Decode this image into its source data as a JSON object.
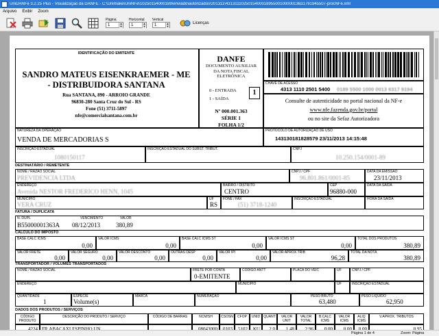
{
  "window": {
    "title": "UniDANFe 3.2.25 Plus - Visualização da DANFE - C:\\Unimake\\UniNFe\\10250154000189\\enviado\\autorizados\\201311\\43131110250154000189550010000013631791945507-procNFe.xml"
  },
  "menu": [
    "Arquivo",
    "Exibir",
    "Zoom"
  ],
  "toolbar": {
    "pagina_label": "Página",
    "pagina_value": "1",
    "horizontal_label": "Horizontal",
    "horizontal_value": "1",
    "vertical_label": "Vertical",
    "vertical_value": "1",
    "licencas_label": "Licenças"
  },
  "emitente": {
    "caption": "IDENTIFICAÇÃO DO EMITENTE",
    "name_line1": "SANDRO MATEUS EISENKRAEMER - ME",
    "name_line2": "- DISTRIBUIDORA SANTANA",
    "address": "Rua SANTANA, 890 - ARROIO GRANDE",
    "city": "96830-280 Santa Cruz do Sul - RS",
    "phone": "Fone (51) 3711-5897",
    "email": "nfe@comercialsantana.com.br"
  },
  "danfe": {
    "title": "DANFE",
    "subtitle": "DOCUMENTO AUXILIAR DA NOTA FISCAL ELETRÔNICA",
    "entrada": "0 - ENTRADA",
    "saida": "1 - SAÍDA",
    "tipo": "1",
    "numero": "Nº 000.001.363",
    "serie": "SÉRIE 1",
    "folha": "FOLHA 1/2"
  },
  "chave": {
    "caption": "CHAVE DE ACESSO",
    "value_visible": "4313 1110 2501 5400",
    "value_blurred": "0189 5500 1000 0013 6317 9194",
    "consulta1": "Consulte de autenticidade no portal nacional da NF-e",
    "consulta_url": "www.nfe.fazenda.gov.br/portal",
    "consulta2": "ou no site da Sefaz Autorizadora"
  },
  "natureza": {
    "caption": "NATUREZA DA OPERAÇÃO",
    "value": "VENDA DE MERCADORIAS S"
  },
  "protocolo": {
    "caption": "PROTOCOLO DE AUTORIZAÇÃO DE USO",
    "value": "143130181828579 23/11/2013 14:15:48"
  },
  "ie": {
    "caption": "INSCRIÇÃO ESTADUAL",
    "value": "1080150117"
  },
  "ie_st": {
    "caption": "INSCRIÇÃO ESTADUAL DO SUBST. TRIBUT."
  },
  "cnpj": {
    "caption": "CNPJ",
    "value": "10.250.154/0001-89"
  },
  "destinatario": {
    "section": "DESTINATÁRIO / REMETENTE",
    "nome_caption": "NOME / RAZÃO SOCIAL",
    "nome": "PREVIDENCIA LTDA",
    "cnpj_caption": "CNPJ / CPF",
    "cnpj": "96.801.861/0001-85",
    "emissao_caption": "DATA DA EMISSÃO",
    "emissao": "23/11/2013",
    "endereco_caption": "ENDEREÇO",
    "endereco": "Avenida NESTOR FREDERICO HENN, 1045",
    "bairro_caption": "BAIRRO / DISTRITO",
    "bairro": "CENTRO",
    "cep_caption": "CEP",
    "cep": "96880-000",
    "saida_caption": "DATA DA SAÍDA",
    "municipio_caption": "MUNICÍPIO",
    "municipio": "VERA CRUZ",
    "uf_caption": "UF",
    "uf": "RS",
    "fone_caption": "FONE / FAX",
    "fone": "(51) 3718-1240",
    "ie_caption": "INSCRIÇÃO ESTADUAL",
    "hora_caption": "HORA DA SAÍDA"
  },
  "fatura": {
    "section": "FATURA / DUPLICATA",
    "ndupl_caption": "N. DUPL",
    "ndupl": "B55000001363A",
    "venc_caption": "VENCIMENTO",
    "venc": "08/12/2013",
    "valor_caption": "VALOR",
    "valor": "380,89"
  },
  "imposto": {
    "section": "CÁLCULO DO IMPOSTO",
    "row1": [
      {
        "caption": "BASE CALC ICMS",
        "value": "0,00"
      },
      {
        "caption": "VALOR ICMS",
        "value": "0,00"
      },
      {
        "caption": "BASE CALC ICMS ST",
        "value": "0,00"
      },
      {
        "caption": "VALOR ICMS ST",
        "value": "0,00"
      },
      {
        "caption": "TOTAL DOS PRODUTOS",
        "value": "380,89"
      }
    ],
    "row2": [
      {
        "caption": "VALOR FRETE",
        "value": "0,00"
      },
      {
        "caption": "VALOR SEGURO",
        "value": "0,00"
      },
      {
        "caption": "VALOR DESCONTO",
        "value": "0,00"
      },
      {
        "caption": "OUTRAS DESP",
        "value": "0,00"
      },
      {
        "caption": "VALOR IPI",
        "value": "0,00"
      },
      {
        "caption": "VALOR APROX.TRIB",
        "value": "96,28"
      },
      {
        "caption": "TOTAL DA NOTA",
        "value": "380,89"
      }
    ]
  },
  "transportador": {
    "section": "TRANSPORTADOR / VOLUMES TRANSPORTADOS",
    "nome_caption": "NOME / RAZÃO SOCIAL",
    "frete_caption": "FRETE POR CONTA",
    "frete": "0-EMITENTE",
    "antt_caption": "CÓDIGO ANTT",
    "placa_caption": "PLACA DO VEIC",
    "uf_caption": "UF",
    "cnpj_caption": "CNPJ / CPF",
    "endereco_caption": "ENDEREÇO",
    "municipio_caption": "MUNICÍPIO",
    "ie_caption": "INSCRIÇÃO ESTADUAL",
    "qtd_caption": "QUANTIDADE",
    "qtd": "1",
    "especie_caption": "ESPÉCIE",
    "especie": "Volume(s)",
    "marca_caption": "MARCA",
    "numeracao_caption": "NUMERAÇÃO",
    "bruto_caption": "PESO BRUTO",
    "bruto": "63,480",
    "liquido_caption": "PESO LÍQUIDO",
    "liquido": "62,950"
  },
  "produtos": {
    "section": "DADOS DOS PRODUTOS / SERVIÇOS",
    "headers": [
      "CÓDIGO PRODUTO",
      "DESCRIÇÃO DO PRODUTO / SERVIÇO",
      "CÓDIGO DE BARRAS",
      "NCM/SH",
      "CSOSN",
      "CFOP",
      "UNID",
      "QUANT",
      "VALOR UNIT",
      "VALOR TOTAL",
      "B.CALC ICMS",
      "VALOR ICMS",
      "ALIQ ICMS",
      "V.APROX. TRIBUTOS"
    ],
    "row": [
      "4224",
      "FR.ABACAXI ESPINHO UN",
      "",
      "08043000",
      "0103",
      "5102",
      "KU",
      "2,0",
      "1,48",
      "2,96",
      "0,00",
      "0,00",
      "0,00",
      "0,95"
    ]
  },
  "status": {
    "page": "Página 1 de 4",
    "zoom": "Zoom: Página"
  }
}
